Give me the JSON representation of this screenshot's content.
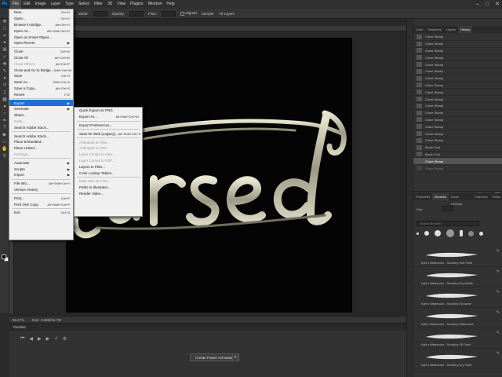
{
  "menubar": {
    "logo": "Ps",
    "items": [
      "File",
      "Edit",
      "Image",
      "Layer",
      "Type",
      "Select",
      "Filter",
      "3D",
      "View",
      "Plugins",
      "Window",
      "Help"
    ],
    "active_index": 0
  },
  "options_bar": {
    "mode_label": "Mode:",
    "opacity_label": "Opacity:",
    "flow_label": "Flow:",
    "aligned_label": "Aligned",
    "sample_label": "Sample:",
    "sample_value": "All Layers"
  },
  "file_menu": {
    "items": [
      {
        "label": "New...",
        "shortcut": "Ctrl+N",
        "disabled": false
      },
      {
        "label": "Open...",
        "shortcut": "Ctrl+O",
        "disabled": false
      },
      {
        "label": "Browse in Bridge...",
        "shortcut": "Alt+Ctrl+O",
        "disabled": false
      },
      {
        "label": "Open As...",
        "shortcut": "Alt+Shift+Ctrl+O",
        "disabled": false
      },
      {
        "label": "Open as Smart Object...",
        "shortcut": "",
        "disabled": false
      },
      {
        "label": "Open Recent",
        "shortcut": "",
        "disabled": false,
        "submenu": true
      },
      {
        "sep": true
      },
      {
        "label": "Close",
        "shortcut": "Ctrl+W",
        "disabled": false
      },
      {
        "label": "Close All",
        "shortcut": "Alt+Ctrl+W",
        "disabled": false
      },
      {
        "label": "Close Others",
        "shortcut": "Alt+Ctrl+P",
        "disabled": true
      },
      {
        "label": "Close and Go to Bridge...",
        "shortcut": "Shift+Ctrl+W",
        "disabled": false
      },
      {
        "label": "Save",
        "shortcut": "Ctrl+S",
        "disabled": false
      },
      {
        "label": "Save As...",
        "shortcut": "Shift+Ctrl+S",
        "disabled": false
      },
      {
        "label": "Save a Copy...",
        "shortcut": "Alt+Ctrl+S",
        "disabled": false
      },
      {
        "label": "Revert",
        "shortcut": "F12",
        "disabled": false
      },
      {
        "sep": true
      },
      {
        "label": "Export",
        "shortcut": "",
        "disabled": false,
        "submenu": true,
        "highlighted": true
      },
      {
        "label": "Generate",
        "shortcut": "",
        "disabled": false,
        "submenu": true
      },
      {
        "label": "Share...",
        "shortcut": "",
        "disabled": false
      },
      {
        "label": "Invite...",
        "shortcut": "",
        "disabled": true
      },
      {
        "label": "Search Adobe Stock...",
        "shortcut": "",
        "disabled": false
      },
      {
        "sep": true
      },
      {
        "label": "Search Adobe Stock...",
        "shortcut": "",
        "disabled": false
      },
      {
        "label": "Place Embedded...",
        "shortcut": "",
        "disabled": false
      },
      {
        "label": "Place Linked...",
        "shortcut": "",
        "disabled": false
      },
      {
        "label": "Package...",
        "shortcut": "",
        "disabled": true
      },
      {
        "sep": true
      },
      {
        "label": "Automate",
        "shortcut": "",
        "disabled": false,
        "submenu": true
      },
      {
        "label": "Scripts",
        "shortcut": "",
        "disabled": false,
        "submenu": true
      },
      {
        "label": "Import",
        "shortcut": "",
        "disabled": false,
        "submenu": true
      },
      {
        "sep": true
      },
      {
        "label": "File Info...",
        "shortcut": "Alt+Shift+Ctrl+I",
        "disabled": false
      },
      {
        "label": "Version History",
        "shortcut": "",
        "disabled": false
      },
      {
        "sep": true
      },
      {
        "label": "Print...",
        "shortcut": "Ctrl+P",
        "disabled": false
      },
      {
        "label": "Print One Copy",
        "shortcut": "Alt+Shift+Ctrl+P",
        "disabled": false
      },
      {
        "sep": true
      },
      {
        "label": "Exit",
        "shortcut": "Ctrl+Q",
        "disabled": false
      }
    ]
  },
  "export_submenu": {
    "items": [
      {
        "label": "Quick Export as PNG",
        "shortcut": "",
        "disabled": false
      },
      {
        "label": "Export As...",
        "shortcut": "Alt+Shift+Ctrl+W",
        "disabled": false
      },
      {
        "sep": true
      },
      {
        "label": "Export Preferences...",
        "shortcut": "",
        "disabled": false
      },
      {
        "sep": true
      },
      {
        "label": "Save for Web (Legacy)...",
        "shortcut": "Alt+Shift+Ctrl+S",
        "disabled": false
      },
      {
        "sep": true
      },
      {
        "label": "Artboards to Files...",
        "shortcut": "",
        "disabled": true
      },
      {
        "label": "Artboards to PDF...",
        "shortcut": "",
        "disabled": true
      },
      {
        "label": "Layer Comps to Files...",
        "shortcut": "",
        "disabled": true
      },
      {
        "label": "Layer Comps to PDF...",
        "shortcut": "",
        "disabled": true
      },
      {
        "label": "Layers to Files...",
        "shortcut": "",
        "disabled": false
      },
      {
        "label": "Color Lookup Tables...",
        "shortcut": "",
        "disabled": false
      },
      {
        "sep": true
      },
      {
        "label": "Data Sets as Files...",
        "shortcut": "",
        "disabled": true
      },
      {
        "label": "Paths to Illustrator...",
        "shortcut": "",
        "disabled": false
      },
      {
        "label": "Render Video...",
        "shortcut": "",
        "disabled": false
      }
    ]
  },
  "statusbar": {
    "zoom": "66.67%",
    "doc_info": "Doc: 2.86M/16.7M"
  },
  "timeline": {
    "title": "Timeline",
    "create_button": "Create Frame Animation"
  },
  "history_panel": {
    "tabs": [
      "Color",
      "Swatches",
      "Layers",
      "History"
    ],
    "active_tab": 3,
    "rows": [
      "Clone Stamp",
      "Clone Stamp",
      "Clone Stamp",
      "Clone Stamp",
      "Clone Stamp",
      "Clone Stamp",
      "Clone Stamp",
      "Clone Stamp",
      "Clone Stamp",
      "Clone Stamp",
      "Clone Stamp",
      "Clone Stamp",
      "Clone Stamp",
      "Clone Stamp",
      "Clone Stamp",
      "Clone Stamp",
      "Brush Tool",
      "Brush Tool",
      "Clone Stamp",
      "Clone Stamp"
    ],
    "selected_index": 18,
    "dimmed_index": 19
  },
  "brushes_panel": {
    "tabs": [
      "Properties",
      "Brushes",
      "Brush Settings",
      "Channels",
      "Paths"
    ],
    "active_tab": 1,
    "size_label": "Size",
    "search_placeholder": "Search Brushes",
    "brushes": [
      "Kyle's Watercolor - Scratchy Soft Paint",
      "Kyle's Watercolor - Scratchy Dry Media",
      "Kyle's Watercolor - Scratchy Gouache",
      "Kyle's Watercolor - Scratchy Watercolor",
      "Kyle's Watercolor - Scratchy Oil Paint",
      "Kyle's Watercolor - Scratchy Dry Paint"
    ]
  }
}
